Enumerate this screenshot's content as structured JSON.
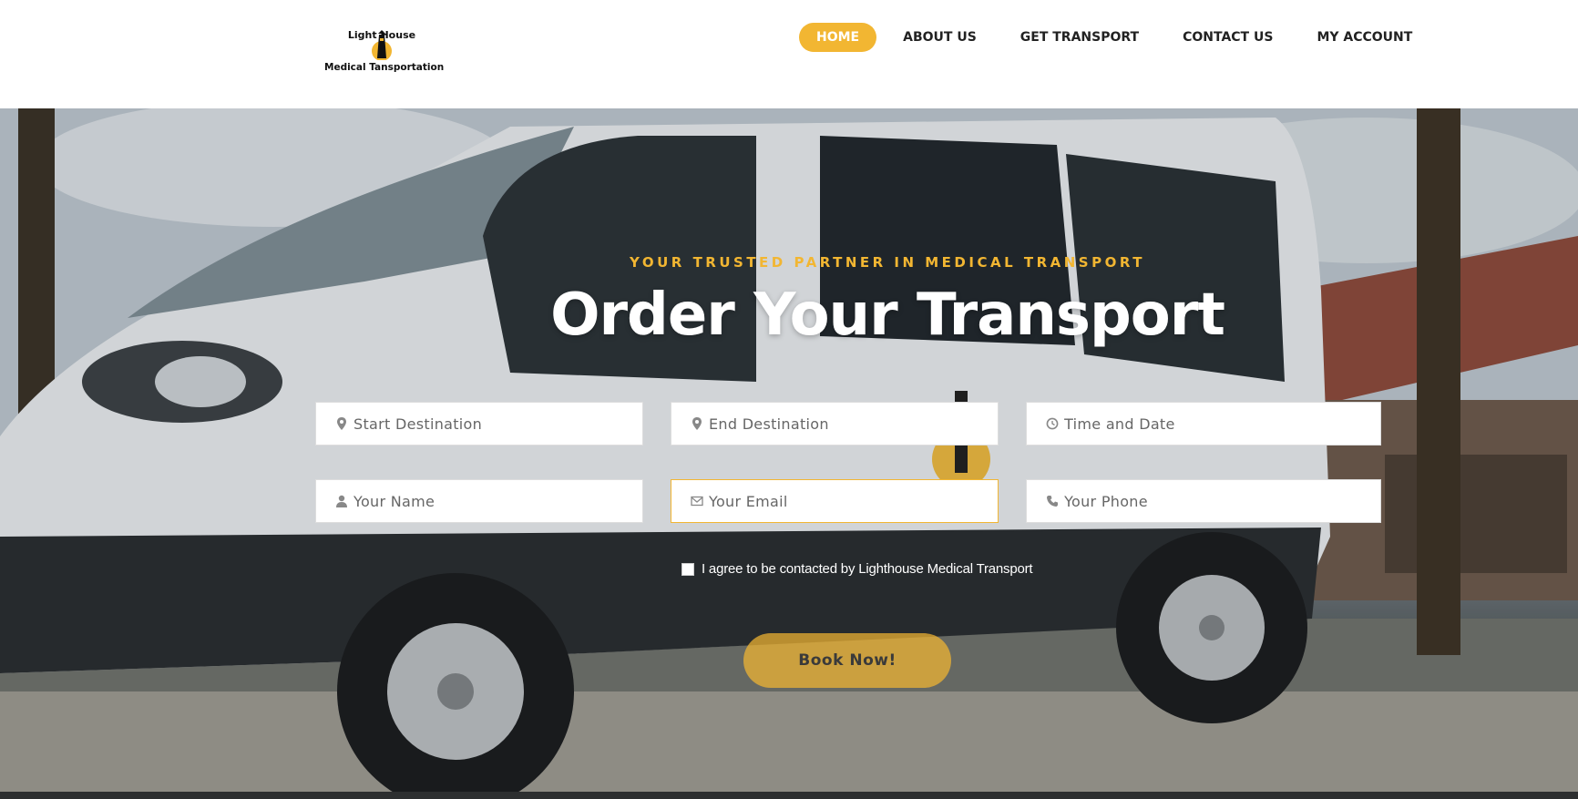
{
  "logo": {
    "line1": "Light   House",
    "line2": "Medical Tansportation"
  },
  "nav": {
    "items": [
      {
        "label": "HOME",
        "active": true
      },
      {
        "label": "ABOUT US",
        "active": false
      },
      {
        "label": "GET TRANSPORT",
        "active": false
      },
      {
        "label": "CONTACT US",
        "active": false
      },
      {
        "label": "MY ACCOUNT",
        "active": false
      }
    ]
  },
  "hero": {
    "tagline": "YOUR TRUSTED PARTNER IN MEDICAL TRANSPORT",
    "title": "Order Your Transport"
  },
  "form": {
    "start_placeholder": "Start Destination",
    "end_placeholder": "End Destination",
    "datetime_placeholder": "Time and Date",
    "name_placeholder": "Your Name",
    "email_placeholder": "Your Email",
    "phone_placeholder": "Your Phone",
    "agree_label": "I agree to be contacted by Lighthouse Medical Transport",
    "agree_checked": false,
    "submit_label": "Book Now!"
  },
  "colors": {
    "accent": "#f2b632",
    "nav_text": "#222222",
    "footer": "#2d2f30"
  },
  "icons": {
    "start": "map-pin-icon",
    "end": "map-pin-icon",
    "datetime": "clock-icon",
    "name": "user-icon",
    "email": "envelope-icon",
    "phone": "phone-icon"
  }
}
